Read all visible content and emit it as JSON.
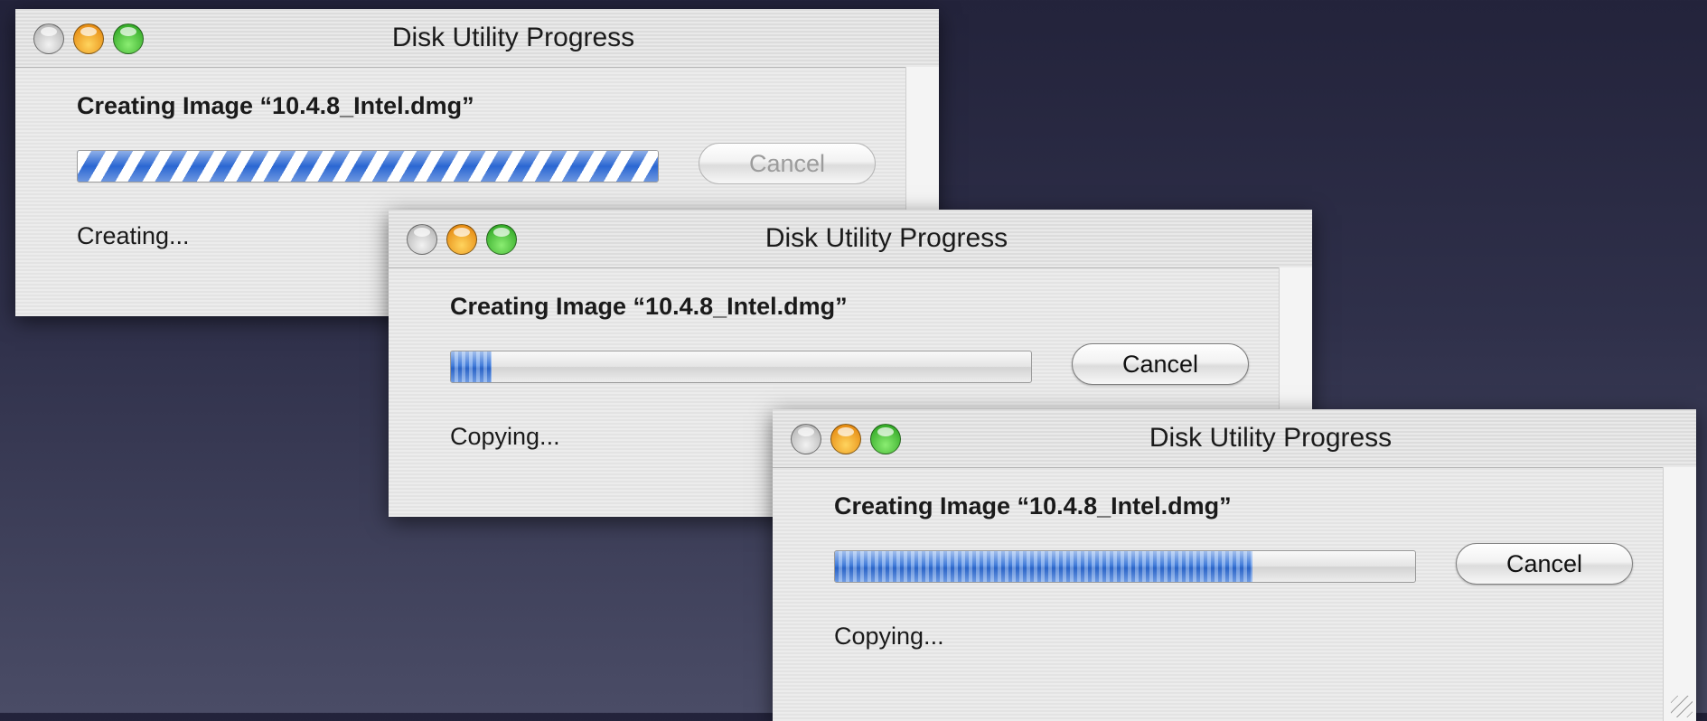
{
  "windows": [
    {
      "title": "Disk Utility Progress",
      "heading": "Creating Image “10.4.8_Intel.dmg”",
      "progress_mode": "indeterminate",
      "progress_fraction": 1.0,
      "cancel_label": "Cancel",
      "cancel_enabled": false,
      "status": "Creating..."
    },
    {
      "title": "Disk Utility Progress",
      "heading": "Creating Image “10.4.8_Intel.dmg”",
      "progress_mode": "determinate",
      "progress_fraction": 0.07,
      "cancel_label": "Cancel",
      "cancel_enabled": true,
      "status": "Copying..."
    },
    {
      "title": "Disk Utility Progress",
      "heading": "Creating Image “10.4.8_Intel.dmg”",
      "progress_mode": "determinate",
      "progress_fraction": 0.72,
      "cancel_label": "Cancel",
      "cancel_enabled": true,
      "status": "Copying..."
    }
  ],
  "icons": {
    "close": "close-light-icon",
    "minimize": "minimize-light-icon",
    "zoom": "zoom-light-icon"
  },
  "colors": {
    "desktop_top": "#23233b",
    "desktop_bottom": "#4a4c66",
    "progress_blue": "#2f6fd6"
  }
}
